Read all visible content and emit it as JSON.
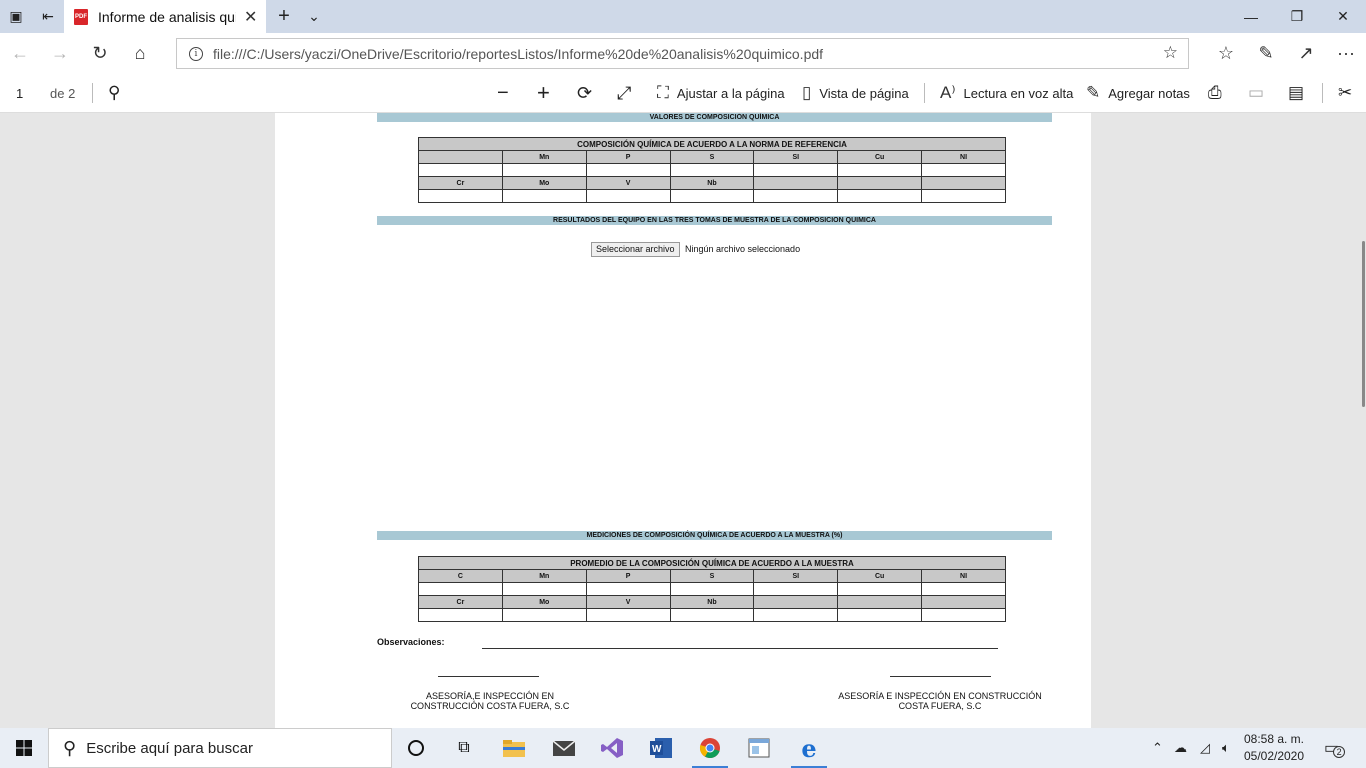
{
  "tab": {
    "title": "Informe de analisis quin",
    "close": "✕"
  },
  "window": {
    "minimize": "—",
    "restore": "❐",
    "close": "✕"
  },
  "address": {
    "url": "file:///C:/Users/yaczi/OneDrive/Escritorio/reportesListos/Informe%20de%20analisis%20quimico.pdf"
  },
  "pdfbar": {
    "page": "1",
    "of": "de 2",
    "fit": "Ajustar a la página",
    "view": "Vista de página",
    "read": "Lectura en voz alta",
    "notes": "Agregar notas"
  },
  "doc": {
    "bar1": "VALORES DE COMPOSICIÓN QUÍMICA",
    "table1": {
      "title": "COMPOSICIÓN QUÍMICA DE ACUERDO A LA NORMA DE REFERENCIA",
      "row1": [
        "",
        "Mn",
        "P",
        "S",
        "SI",
        "Cu",
        "NI"
      ],
      "row2": [
        "Cr",
        "Mo",
        "V",
        "Nb",
        "",
        "",
        ""
      ]
    },
    "bar2": "RESULTADOS DEL EQUIPO EN LAS TRES TOMAS DE MUESTRA DE LA COMPOSICION QUIMICA",
    "file_button": "Seleccionar archivo",
    "file_status": "Ningún archivo seleccionado",
    "bar3": "MEDICIONES DE COMPOSICIÓN QUÍMICA DE ACUERDO A LA MUESTRA (%)",
    "table2": {
      "title": "PROMEDIO DE LA COMPOSICIÓN QUÍMICA DE ACUERDO A LA MUESTRA",
      "row1": [
        "C",
        "Mn",
        "P",
        "S",
        "SI",
        "Cu",
        "NI"
      ],
      "row2": [
        "Cr",
        "Mo",
        "V",
        "Nb",
        "",
        "",
        ""
      ]
    },
    "observations": "Observaciones:",
    "sign_left": [
      "ASESORÍA,E INSPECCIÓN EN",
      "CONSTRUCCIÓN COSTA FUERA, S.C"
    ],
    "sign_right": [
      "ASESORÍA E INSPECCIÓN EN CONSTRUCCIÓN",
      "COSTA FUERA, S.C"
    ]
  },
  "taskbar": {
    "search_placeholder": "Escribe aquí para buscar",
    "time": "08:58 a. m.",
    "date": "05/02/2020",
    "notifications": "2"
  }
}
